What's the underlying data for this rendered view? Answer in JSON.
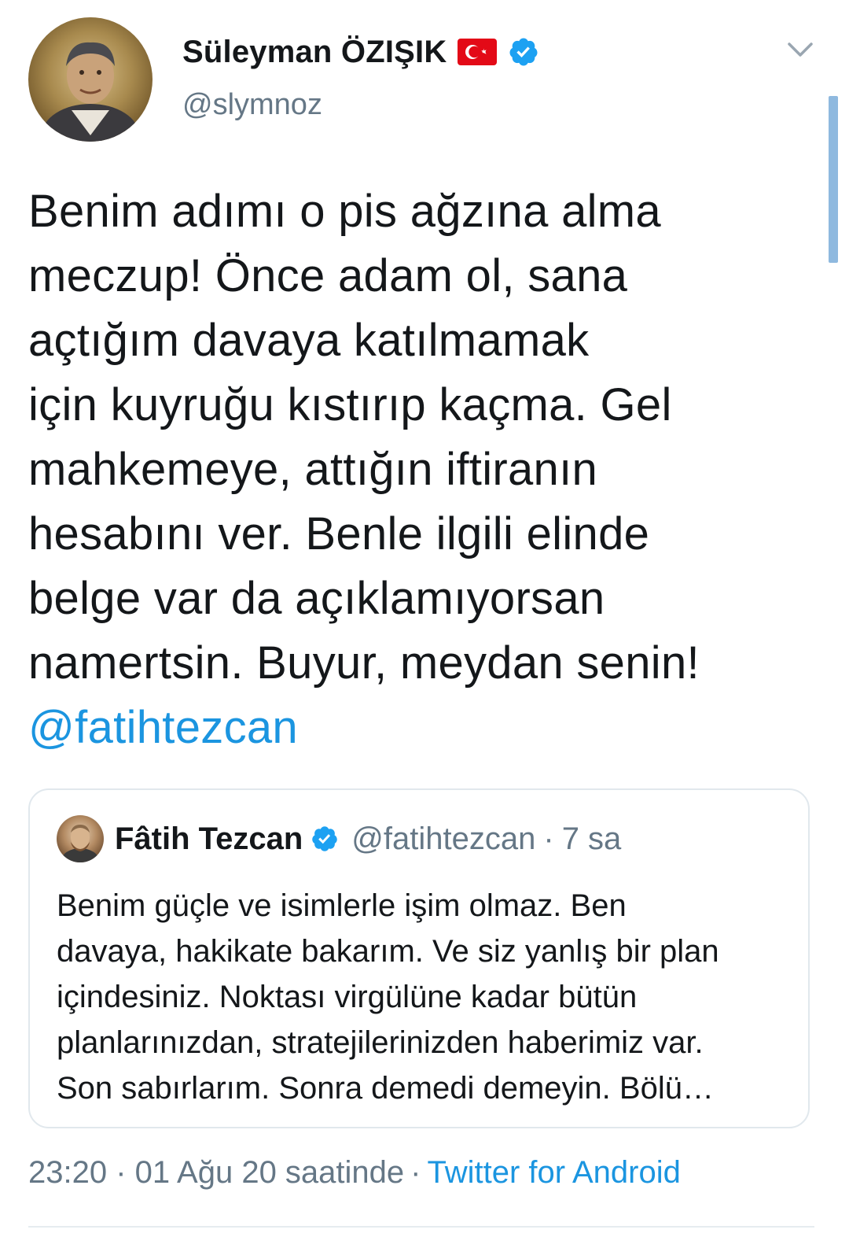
{
  "author": {
    "display_name": "Süleyman ÖZIŞIK",
    "handle": "@slymnoz",
    "avatar_icon": "profile-portrait",
    "flag_icon": "turkey-flag-icon",
    "verified_icon": "verified-badge-icon"
  },
  "tweet": {
    "text": "Benim adımı o pis ağzına alma\nmeczup! Önce adam ol, sana\naçtığım davaya katılmamak\niçin kuyruğu kıstırıp kaçma. Gel\nmahkemeye, attığın iftiranın\nhesabını ver. Benle ilgili elinde\nbelge var da açıklamıyorsan\nnamertsin. Buyur, meydan senin!",
    "mention": "@fatihtezcan"
  },
  "quoted_tweet": {
    "display_name": "Fâtih Tezcan",
    "handle": "@fatihtezcan",
    "separator": "·",
    "time": "7 sa",
    "text": "Benim güçle ve isimlerle işim olmaz. Ben\ndavaya, hakikate bakarım. Ve siz yanlış bir plan\niçindesiniz. Noktası virgülüne kadar bütün\nplanlarınızdan, stratejilerinizden haberimiz var.\nSon sabırlarım. Sonra demedi demeyin. Bölü…"
  },
  "meta": {
    "timestamp": "23:20 · 01 Ağu 20 saatinde",
    "separator": "·",
    "source": "Twitter for Android"
  },
  "colors": {
    "link": "#1b95e0",
    "secondary_text": "#657786",
    "primary_text": "#14171a",
    "verified": "#1da1f2",
    "flag_red": "#e30a17"
  }
}
